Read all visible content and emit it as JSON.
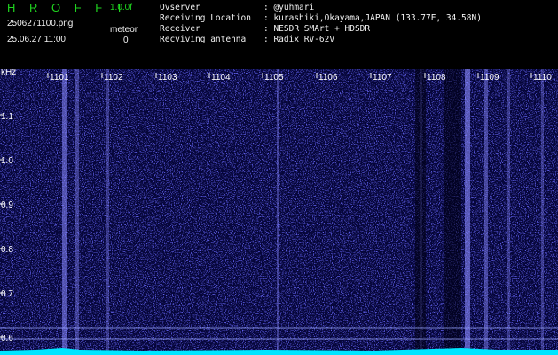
{
  "header": {
    "app_title": "H R O F F T",
    "version": "1.0.0f",
    "filename": "2506271100.png",
    "datetime": "25.06.27 11:00",
    "meteor_label": "meteor",
    "meteor_count": "0",
    "info": [
      {
        "key": "Ovserver",
        "value": ": @yuhmari"
      },
      {
        "key": "Receiving Location",
        "value": ": kurashiki,Okayama,JAPAN (133.77E, 34.58N)"
      },
      {
        "key": "Receiver",
        "value": ": NESDR SMArt + HDSDR"
      },
      {
        "key": "Recviving antenna",
        "value": ": Radix RV-62V"
      }
    ]
  },
  "spectrogram": {
    "y_unit": "kHz",
    "y_ticks": [
      "1.1",
      "1.0",
      "0.9",
      "0.8",
      "0.7",
      "0.6"
    ],
    "x_ticks": [
      "1101",
      "1102",
      "1103",
      "1104",
      "1105",
      "1106",
      "1107",
      "1108",
      "1109",
      "1110"
    ],
    "colors": {
      "background": "#06063a",
      "noise": "#2a2ad0",
      "signal": "#8a8aff",
      "baseline": "#00e5ff"
    }
  }
}
